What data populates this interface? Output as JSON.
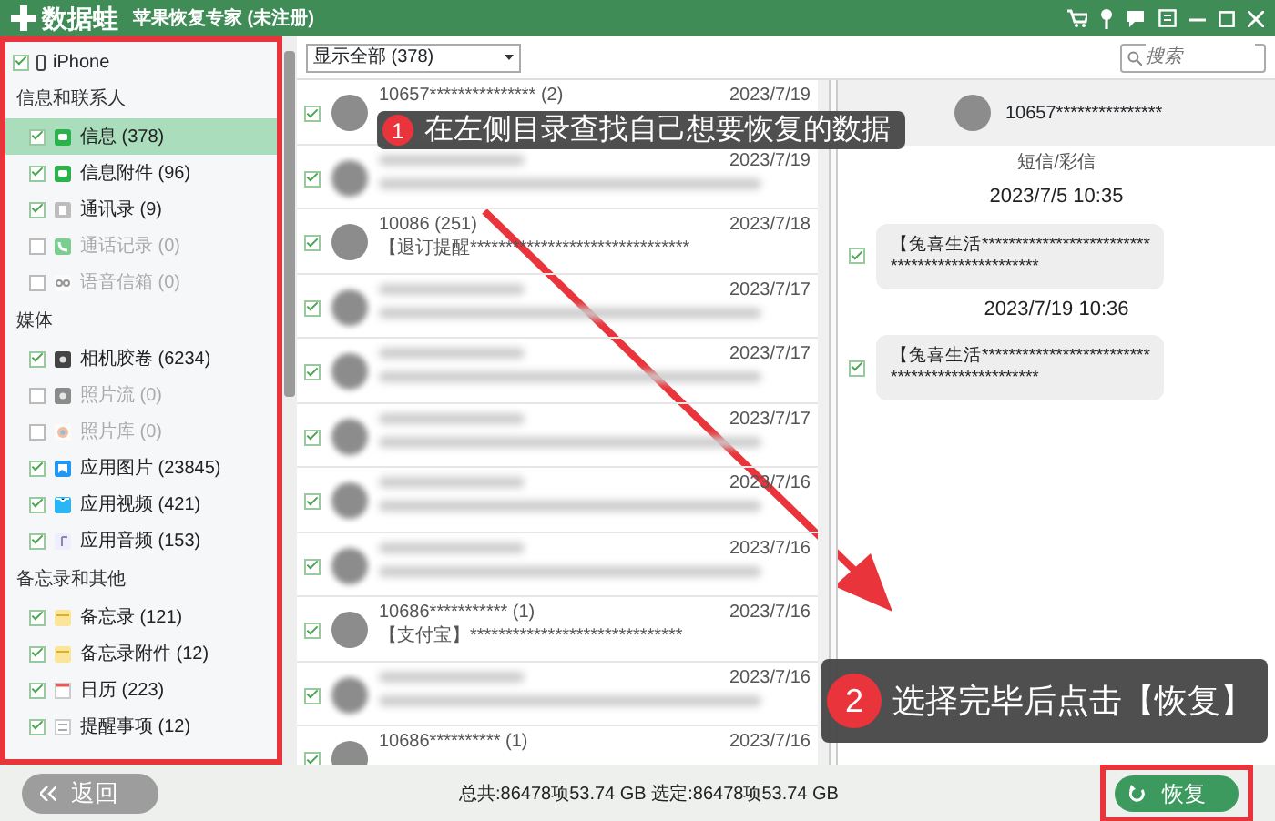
{
  "window": {
    "logo_text": "数据蛙",
    "title": "苹果恢复专家 (未注册)"
  },
  "sidebar": {
    "device": {
      "label": "iPhone",
      "checked": true
    },
    "groups": [
      {
        "title": "信息和联系人",
        "items": [
          {
            "label": "信息 (378)",
            "kind": "message",
            "checked": true,
            "disabled": false,
            "selected": true
          },
          {
            "label": "信息附件 (96)",
            "kind": "message",
            "checked": true,
            "disabled": false,
            "selected": false
          },
          {
            "label": "通讯录 (9)",
            "kind": "contacts",
            "checked": true,
            "disabled": false,
            "selected": false
          },
          {
            "label": "通话记录 (0)",
            "kind": "phone",
            "checked": false,
            "disabled": true,
            "selected": false
          },
          {
            "label": "语音信箱 (0)",
            "kind": "voicemail",
            "checked": false,
            "disabled": true,
            "selected": false
          }
        ]
      },
      {
        "title": "媒体",
        "items": [
          {
            "label": "相机胶卷 (6234)",
            "kind": "camera",
            "checked": true,
            "disabled": false,
            "selected": false
          },
          {
            "label": "照片流 (0)",
            "kind": "camera",
            "checked": false,
            "disabled": true,
            "selected": false
          },
          {
            "label": "照片库 (0)",
            "kind": "photos",
            "checked": false,
            "disabled": true,
            "selected": false
          },
          {
            "label": "应用图片 (23845)",
            "kind": "image",
            "checked": true,
            "disabled": false,
            "selected": false
          },
          {
            "label": "应用视频 (421)",
            "kind": "video",
            "checked": true,
            "disabled": false,
            "selected": false
          },
          {
            "label": "应用音频 (153)",
            "kind": "audio",
            "checked": true,
            "disabled": false,
            "selected": false
          }
        ]
      },
      {
        "title": "备忘录和其他",
        "items": [
          {
            "label": "备忘录 (121)",
            "kind": "notes",
            "checked": true,
            "disabled": false,
            "selected": false
          },
          {
            "label": "备忘录附件 (12)",
            "kind": "notes",
            "checked": true,
            "disabled": false,
            "selected": false
          },
          {
            "label": "日历 (223)",
            "kind": "calendar",
            "checked": true,
            "disabled": false,
            "selected": false
          },
          {
            "label": "提醒事项 (12)",
            "kind": "reminders",
            "checked": true,
            "disabled": false,
            "selected": false
          }
        ]
      }
    ]
  },
  "toolbar": {
    "filter": "显示全部 (378)",
    "search": {
      "placeholder": "搜索"
    }
  },
  "messages": [
    {
      "name": "10657*************** (2)",
      "date": "2023/7/19",
      "checked": true,
      "blurred": false
    },
    {
      "date": "2023/7/19",
      "checked": true,
      "blurred": true
    },
    {
      "name": "10086 (251)",
      "preview": "【退订提醒*******************************",
      "date": "2023/7/18",
      "checked": true,
      "blurred": false
    },
    {
      "date": "2023/7/17",
      "checked": true,
      "blurred": true
    },
    {
      "date": "2023/7/17",
      "checked": true,
      "blurred": true
    },
    {
      "date": "2023/7/17",
      "checked": true,
      "blurred": true
    },
    {
      "date": "2023/7/16",
      "checked": true,
      "blurred": true
    },
    {
      "date": "2023/7/16",
      "checked": true,
      "blurred": true
    },
    {
      "name": "10686*********** (1)",
      "preview": "【支付宝】******************************",
      "date": "2023/7/16",
      "checked": true,
      "blurred": false
    },
    {
      "date": "2023/7/16",
      "checked": true,
      "blurred": true
    },
    {
      "name": "10686********** (1)",
      "date": "2023/7/16",
      "checked": true,
      "blurred": false
    }
  ],
  "detail": {
    "contact": "10657***************",
    "channel": "短信/彩信",
    "conversation": [
      {
        "kind": "time",
        "text": "2023/7/5 10:35"
      },
      {
        "kind": "bubble",
        "lines": [
          "【兔喜生活*************************",
          "**********************"
        ],
        "checked": true
      },
      {
        "kind": "time",
        "text": "2023/7/19 10:36"
      },
      {
        "kind": "bubble",
        "lines": [
          "【兔喜生活*************************",
          "**********************"
        ],
        "checked": true
      }
    ]
  },
  "footer": {
    "back": "返回",
    "summary": "总共:86478项53.74 GB 选定:86478项53.74 GB",
    "restore": "恢复"
  },
  "annotations": [
    {
      "number": "1",
      "text": "在左侧目录查找自己想要恢复的数据"
    },
    {
      "number": "2",
      "text": "选择完毕后点击【恢复】"
    }
  ]
}
